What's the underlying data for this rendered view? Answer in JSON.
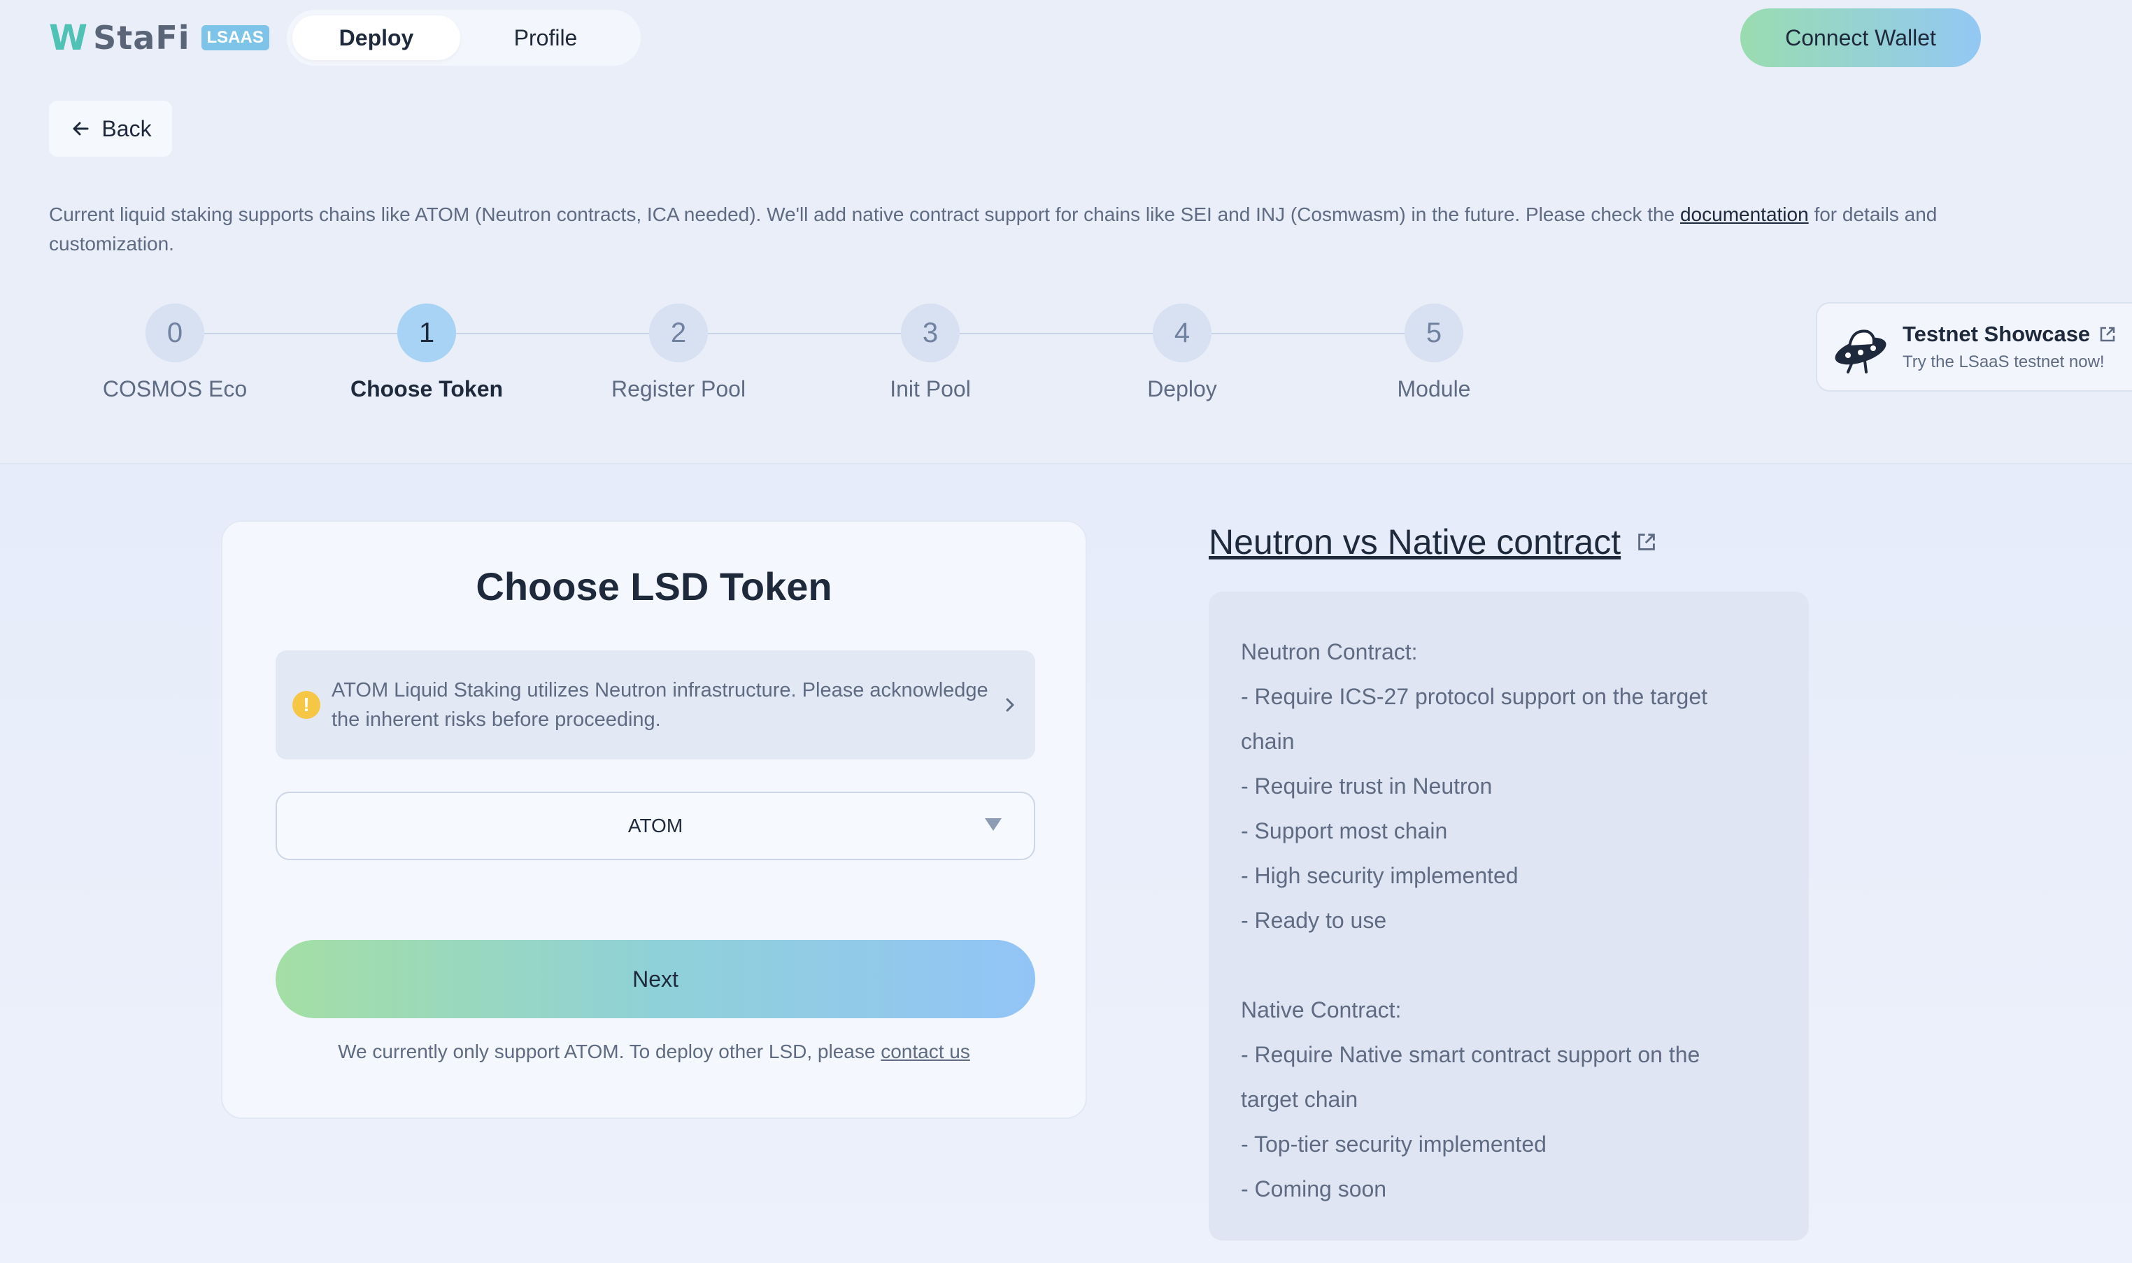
{
  "header": {
    "logo_mark": "W",
    "logo_text": "StaFi",
    "logo_badge": "LSAAS",
    "tabs": [
      {
        "label": "Deploy",
        "active": true
      },
      {
        "label": "Profile",
        "active": false
      }
    ],
    "connect_wallet": "Connect Wallet"
  },
  "back_label": "Back",
  "notice": {
    "text_before": "Current liquid staking supports chains like ATOM (Neutron contracts, ICA needed). We'll add native contract support for chains like SEI and INJ (Cosmwasm) in the future. Please check the ",
    "link": "documentation",
    "text_after": " for details and customization."
  },
  "stepper": {
    "current_step": 1,
    "steps": [
      {
        "number": "0",
        "label": "COSMOS Eco"
      },
      {
        "number": "1",
        "label": "Choose Token"
      },
      {
        "number": "2",
        "label": "Register Pool"
      },
      {
        "number": "3",
        "label": "Init Pool"
      },
      {
        "number": "4",
        "label": "Deploy"
      },
      {
        "number": "5",
        "label": "Module"
      }
    ]
  },
  "showcase": {
    "title": "Testnet Showcase",
    "subtitle": "Try the LSaaS testnet now!"
  },
  "card": {
    "title": "Choose LSD Token",
    "warning": "ATOM Liquid Staking utilizes Neutron infrastructure. Please acknowledge the inherent risks before proceeding.",
    "selected_token": "ATOM",
    "next_label": "Next",
    "support_text": "We currently only support ATOM. To deploy other LSD, please ",
    "contact_link": "contact us"
  },
  "comparison": {
    "title": "Neutron vs Native contract",
    "lines": [
      "Neutron Contract:",
      "- Require ICS-27 protocol support on the target",
      "chain",
      "- Require trust in Neutron",
      "- Support most chain",
      "- High security implemented",
      "- Ready to use",
      "",
      "Native Contract:",
      "- Require Native smart contract support on the",
      "target chain",
      "- Top-tier security implemented",
      "- Coming soon"
    ]
  },
  "colors": {
    "background": "#e9eef9",
    "accent_gradient_start": "#9adcb0",
    "accent_gradient_end": "#93c8f4",
    "active_step": "#a9d3f5",
    "warning_icon": "#f6c744"
  }
}
